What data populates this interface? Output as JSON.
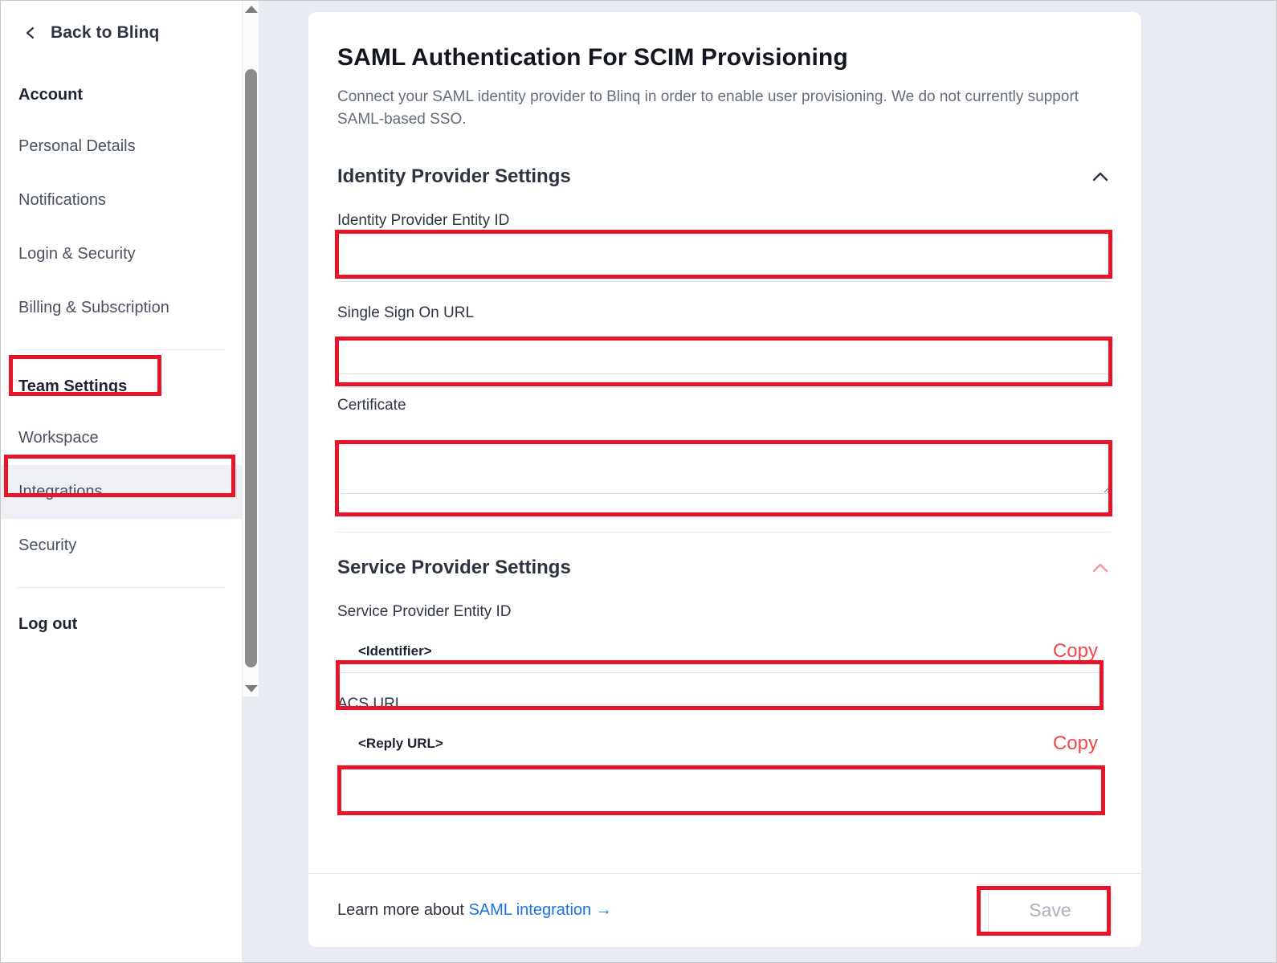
{
  "sidebar": {
    "back": {
      "label": "Back to Blinq",
      "icon": "chevron-left-icon"
    },
    "groups": [
      {
        "items": [
          {
            "label": "Account",
            "heading": true,
            "active": false
          },
          {
            "label": "Personal Details",
            "heading": false,
            "active": false
          },
          {
            "label": "Notifications",
            "heading": false,
            "active": false
          },
          {
            "label": "Login & Security",
            "heading": false,
            "active": false
          },
          {
            "label": "Billing & Subscription",
            "heading": false,
            "active": false
          }
        ]
      },
      {
        "items": [
          {
            "label": "Team Settings",
            "heading": true,
            "active": false
          },
          {
            "label": "Workspace",
            "heading": false,
            "active": false
          },
          {
            "label": "Integrations",
            "heading": false,
            "active": true
          },
          {
            "label": "Security",
            "heading": false,
            "active": false
          }
        ]
      },
      {
        "items": [
          {
            "label": "Log out",
            "heading": true,
            "active": false
          }
        ]
      }
    ]
  },
  "main": {
    "title": "SAML Authentication For SCIM Provisioning",
    "subtitle": "Connect your SAML identity provider to Blinq in order to enable user provisioning. We do not currently support SAML-based SSO.",
    "identity_section": {
      "title": "Identity Provider Settings",
      "collapse_icon": "chevron-up-icon",
      "fields": [
        {
          "label": "Identity Provider Entity ID",
          "value": "",
          "placeholder": ""
        },
        {
          "label": "Single Sign On URL",
          "value": "",
          "placeholder": ""
        },
        {
          "label": "Certificate",
          "value": "",
          "placeholder": ""
        }
      ]
    },
    "service_section": {
      "title": "Service Provider Settings",
      "collapse_icon": "chevron-up-icon",
      "rows": [
        {
          "label": "Service Provider Entity ID",
          "value": "<Identifier>",
          "action": "Copy"
        },
        {
          "label": "ACS URL",
          "value": "<Reply URL>",
          "action": "Copy"
        }
      ]
    }
  },
  "footer": {
    "learn_prefix": "Learn more about",
    "learn_link": "SAML integration",
    "learn_arrow": "→",
    "save_label": "Save"
  },
  "colors": {
    "highlight": "#e8152a",
    "copy_link": "#f2484a",
    "learn_link": "#1a73e8",
    "page_bg": "#e8ebf2",
    "active_item_bg": "#eef0f5"
  }
}
